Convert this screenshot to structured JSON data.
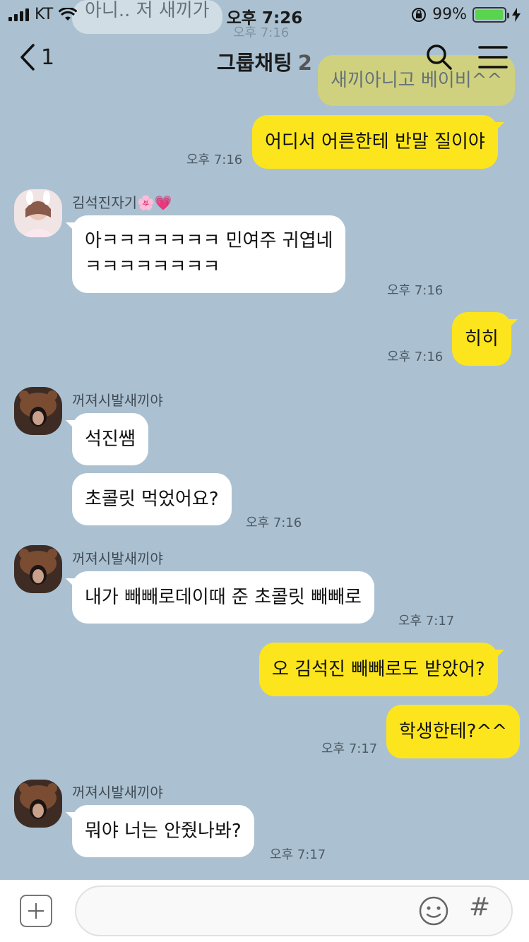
{
  "status": {
    "carrier": "KT",
    "time": "오후 7:26",
    "battery": "99%",
    "battery_level": 0.99
  },
  "header": {
    "back_count": "1",
    "title": "그룹채팅",
    "member_count": "2"
  },
  "ghost_messages": [
    {
      "text": "아니.. 저 새끼가",
      "time": "오후 7:16"
    },
    {
      "text": "새끼아니고 베이비^^"
    }
  ],
  "messages": [
    {
      "text": "어디서 어른한테 반말 질이야",
      "time": "오후 7:16"
    },
    {
      "sender": "김석진자기",
      "sender_emoji_1": "🌸",
      "sender_emoji_2": "💗",
      "line1": "아ㅋㅋㅋㅋㅋㅋㅋ 민여주 귀엽네",
      "line2": "ㅋㅋㅋㅋㅋㅋㅋㅋ",
      "time": "오후 7:16"
    },
    {
      "text": "히히",
      "time": "오후 7:16"
    },
    {
      "sender": "꺼져시발새끼야",
      "text": "석진쌤"
    },
    {
      "text": "초콜릿 먹었어요?",
      "time": "오후 7:16"
    },
    {
      "sender": "꺼져시발새끼야",
      "text": "내가 빼빼로데이때 준 초콜릿 빼빼로",
      "time": "오후 7:17"
    },
    {
      "text": "오 김석진 빼빼로도 받았어?"
    },
    {
      "text": "학생한테?^^",
      "time": "오후 7:17"
    },
    {
      "sender": "꺼져시발새끼야",
      "text": "뭐야 너는 안줬나봐?",
      "time": "오후 7:17"
    }
  ],
  "input": {
    "placeholder": ""
  },
  "colors": {
    "background": "#abc1d1",
    "my_bubble": "#fce51c",
    "other_bubble": "#ffffff"
  }
}
